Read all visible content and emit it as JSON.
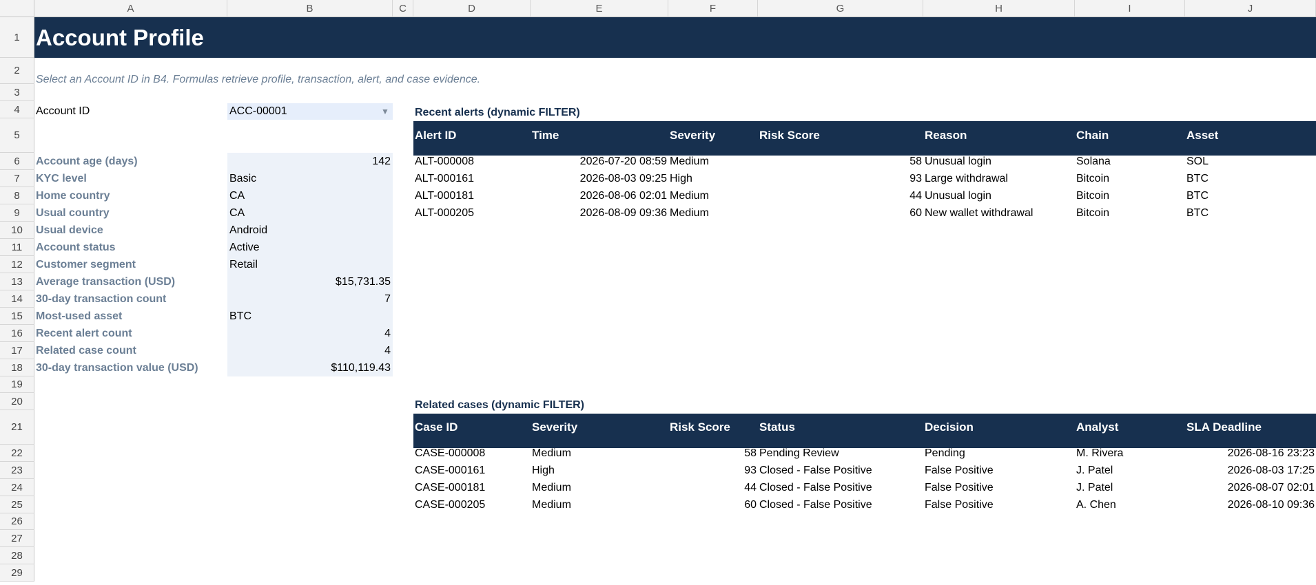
{
  "columns": [
    "A",
    "B",
    "C",
    "D",
    "E",
    "F",
    "G",
    "H",
    "I",
    "J"
  ],
  "rows": [
    "1",
    "2",
    "3",
    "4",
    "5",
    "6",
    "7",
    "8",
    "9",
    "10",
    "11",
    "12",
    "13",
    "14",
    "15",
    "16",
    "17",
    "18",
    "19",
    "20",
    "21",
    "22",
    "23",
    "24",
    "25",
    "26",
    "27",
    "28",
    "29"
  ],
  "header": {
    "title": "Account Profile",
    "subtitle": "Select an Account ID in B4. Formulas retrieve profile, transaction, alert, and case evidence."
  },
  "account": {
    "label": "Account ID",
    "value": "ACC-00001"
  },
  "profile": [
    {
      "label": "Account age (days)",
      "value": "142"
    },
    {
      "label": "KYC level",
      "value": "Basic"
    },
    {
      "label": "Home country",
      "value": "CA"
    },
    {
      "label": "Usual country",
      "value": "CA"
    },
    {
      "label": "Usual device",
      "value": "Android"
    },
    {
      "label": "Account status",
      "value": "Active"
    },
    {
      "label": "Customer segment",
      "value": "Retail"
    },
    {
      "label": "Average transaction (USD)",
      "value": "$15,731.35"
    },
    {
      "label": "30-day transaction count",
      "value": "7"
    },
    {
      "label": "Most-used asset",
      "value": "BTC"
    },
    {
      "label": "Recent alert count",
      "value": "4"
    },
    {
      "label": "Related case count",
      "value": "4"
    },
    {
      "label": "30-day transaction value (USD)",
      "value": "$110,119.43"
    }
  ],
  "alerts": {
    "title": "Recent alerts (dynamic FILTER)",
    "headers": [
      "Alert ID",
      "Time",
      "Severity",
      "Risk Score",
      "Reason",
      "Chain",
      "Asset"
    ],
    "rows": [
      [
        "ALT-000008",
        "2026-07-20 08:59",
        "Medium",
        "58",
        "Unusual login",
        "Solana",
        "SOL"
      ],
      [
        "ALT-000161",
        "2026-08-03 09:25",
        "High",
        "93",
        "Large withdrawal",
        "Bitcoin",
        "BTC"
      ],
      [
        "ALT-000181",
        "2026-08-06 02:01",
        "Medium",
        "44",
        "Unusual login",
        "Bitcoin",
        "BTC"
      ],
      [
        "ALT-000205",
        "2026-08-09 09:36",
        "Medium",
        "60",
        "New wallet withdrawal",
        "Bitcoin",
        "BTC"
      ]
    ]
  },
  "cases": {
    "title": "Related cases (dynamic FILTER)",
    "headers": [
      "Case ID",
      "Severity",
      "Risk Score",
      "Status",
      "Decision",
      "Analyst",
      "SLA Deadline"
    ],
    "rows": [
      [
        "CASE-000008",
        "Medium",
        "58",
        "Pending Review",
        "Pending",
        "M. Rivera",
        "2026-08-16 23:23"
      ],
      [
        "CASE-000161",
        "High",
        "93",
        "Closed - False Positive",
        "False Positive",
        "J. Patel",
        "2026-08-03 17:25"
      ],
      [
        "CASE-000181",
        "Medium",
        "44",
        "Closed - False Positive",
        "False Positive",
        "J. Patel",
        "2026-08-07 02:01"
      ],
      [
        "CASE-000205",
        "Medium",
        "60",
        "Closed - False Positive",
        "False Positive",
        "A. Chen",
        "2026-08-10 09:36"
      ]
    ]
  }
}
